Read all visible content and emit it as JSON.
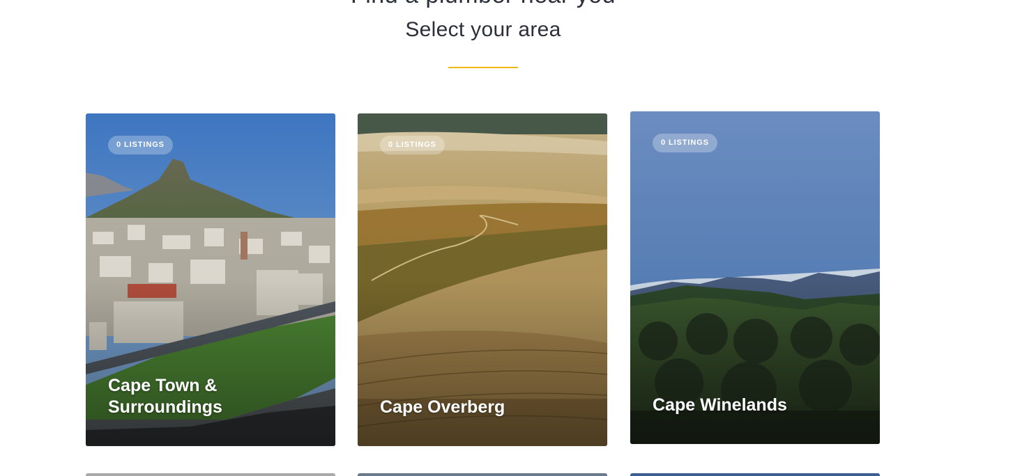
{
  "header": {
    "title": "Find a plumber near you",
    "subtitle": "Select your area"
  },
  "colors": {
    "accent": "#f0b90b",
    "heading": "#2b2f3a"
  },
  "areas": [
    {
      "badge": "0 LISTINGS",
      "title": "Cape Town & Surroundings"
    },
    {
      "badge": "0 LISTINGS",
      "title": "Cape Overberg"
    },
    {
      "badge": "0 LISTINGS",
      "title": "Cape Winelands"
    }
  ]
}
